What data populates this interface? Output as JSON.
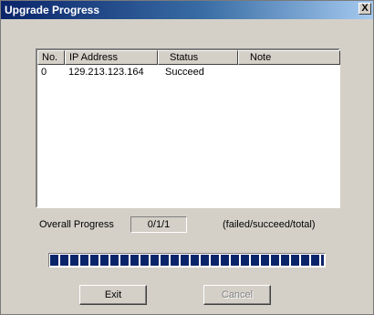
{
  "window": {
    "title": "Upgrade Progress",
    "close_label": "X"
  },
  "list": {
    "columns": [
      "No.",
      "IP Address",
      "Status",
      "Note"
    ],
    "rows": [
      {
        "no": "0",
        "ip": "129.213.123.164",
        "status": "Succeed",
        "note": ""
      }
    ]
  },
  "progress": {
    "label": "Overall Progress",
    "value": "0/1/1",
    "legend": "(failed/succeed/total)",
    "fraction": 1.0
  },
  "buttons": {
    "exit": "Exit",
    "cancel": "Cancel"
  },
  "colors": {
    "title_start": "#0a246a",
    "progress_fill": "#0a246a",
    "face": "#d4d0c8"
  }
}
